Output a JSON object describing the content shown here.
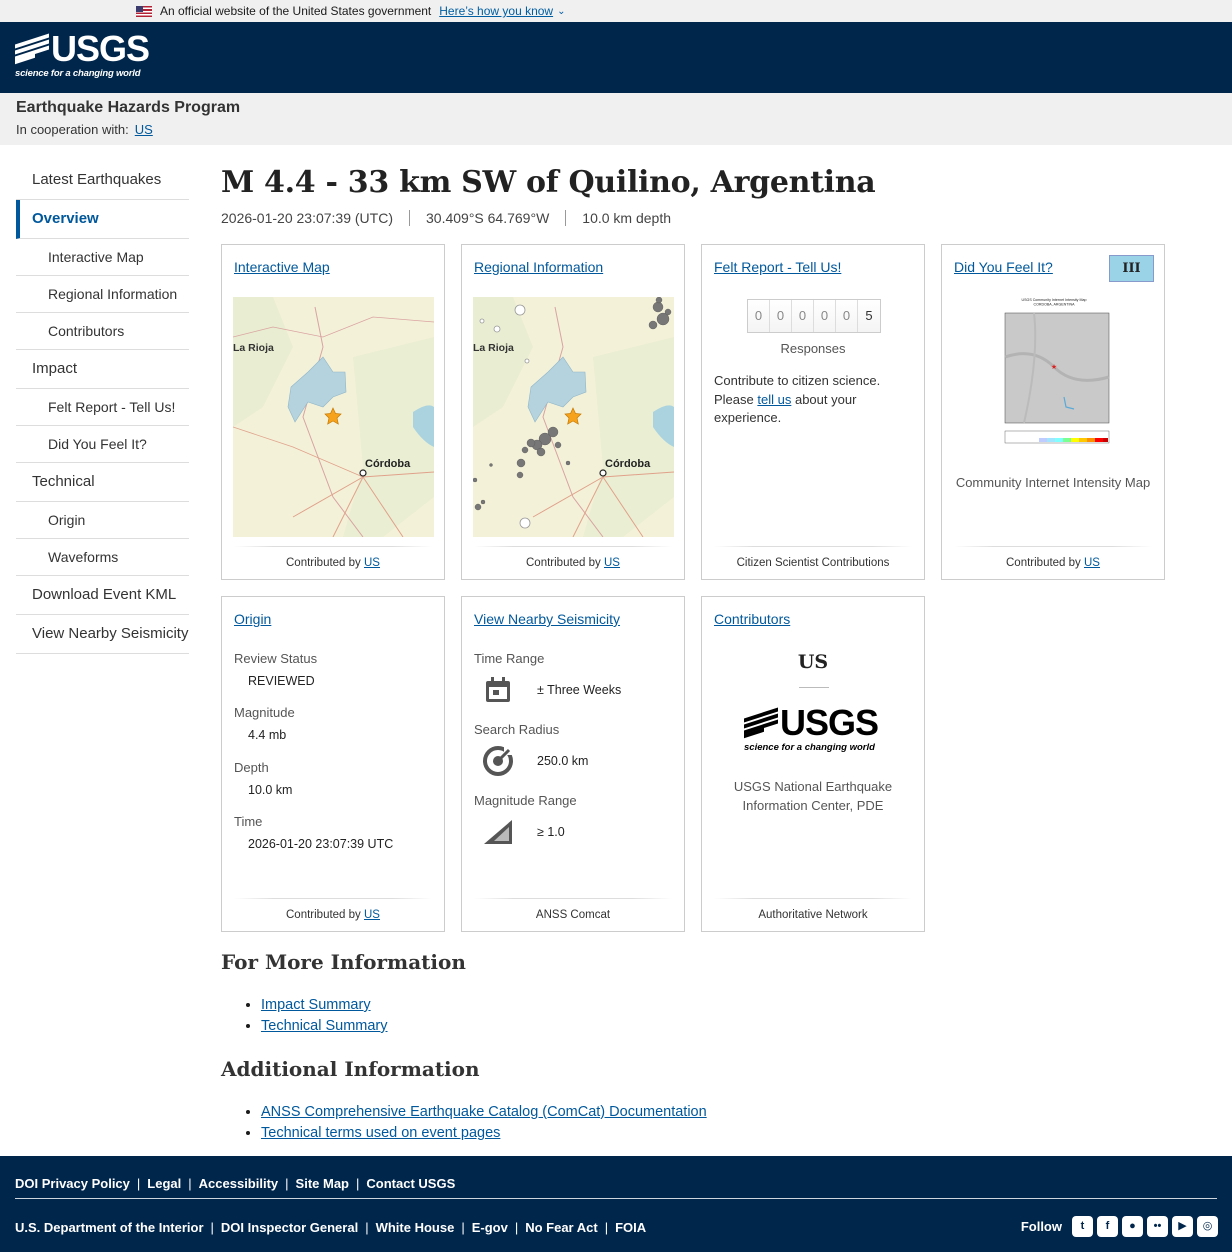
{
  "gov_banner": {
    "text": "An official website of the United States government",
    "link": "Here’s how you know"
  },
  "header": {
    "logo_text": "USGS",
    "logo_tagline": "science for a changing world"
  },
  "site": {
    "title": "Earthquake Hazards Program",
    "coop_label": "In cooperation with:",
    "coop_link": "US"
  },
  "sidebar": {
    "items": [
      {
        "label": "Latest Earthquakes"
      },
      {
        "label": "Overview"
      },
      {
        "label": "Interactive Map"
      },
      {
        "label": "Regional Information"
      },
      {
        "label": "Contributors"
      },
      {
        "label": "Impact"
      },
      {
        "label": "Felt Report - Tell Us!"
      },
      {
        "label": "Did You Feel It?"
      },
      {
        "label": "Technical"
      },
      {
        "label": "Origin"
      },
      {
        "label": "Waveforms"
      },
      {
        "label": "Download Event KML"
      },
      {
        "label": "View Nearby Seismicity"
      }
    ]
  },
  "event": {
    "title": "M 4.4 - 33 km SW of Quilino, Argentina",
    "time": "2026-01-20 23:07:39 (UTC)",
    "location": "30.409°S 64.769°W",
    "depth": "10.0 km depth"
  },
  "cards": {
    "map": {
      "title": "Interactive Map",
      "foot_prefix": "Contributed by",
      "foot_link": "US",
      "label_la_rioja": "La Rioja",
      "label_cordoba": "Córdoba"
    },
    "regional": {
      "title": "Regional Information",
      "foot_prefix": "Contributed by",
      "foot_link": "US",
      "label_la_rioja": "La Rioja",
      "label_cordoba": "Córdoba"
    },
    "felt": {
      "title": "Felt Report - Tell Us!",
      "digits": [
        "0",
        "0",
        "0",
        "0",
        "0",
        "5"
      ],
      "responses_label": "Responses",
      "text_1": "Contribute to citizen science. Please",
      "link": "tell us",
      "text_2": "about your experience.",
      "foot": "Citizen Scientist Contributions"
    },
    "dyfi": {
      "title": "Did You Feel It?",
      "mmi": "III",
      "caption": "Community Internet Intensity Map",
      "foot_prefix": "Contributed by",
      "foot_link": "US",
      "map_title": "USGS Community Internet Intensity Map",
      "map_subtitle": "CORDOBA, ARGENTINA"
    },
    "origin": {
      "title": "Origin",
      "review_label": "Review Status",
      "review_value": "REVIEWED",
      "magnitude_label": "Magnitude",
      "magnitude_value": "4.4 mb",
      "depth_label": "Depth",
      "depth_value": "10.0 km",
      "time_label": "Time",
      "time_value": "2026-01-20 23:07:39 UTC",
      "foot_prefix": "Contributed by",
      "foot_link": "US"
    },
    "nearby": {
      "title": "View Nearby Seismicity",
      "time_label": "Time Range",
      "time_value": "± Three Weeks",
      "radius_label": "Search Radius",
      "radius_value": "250.0 km",
      "mag_label": "Magnitude Range",
      "mag_value": "≥ 1.0",
      "foot": "ANSS Comcat"
    },
    "contributors": {
      "title": "Contributors",
      "code": "US",
      "logo_text": "USGS",
      "logo_tagline": "science for a changing world",
      "name": "USGS National Earthquake Information Center, PDE",
      "foot": "Authoritative Network"
    }
  },
  "more_info": {
    "heading": "For More Information",
    "links": [
      "Impact Summary",
      "Technical Summary"
    ]
  },
  "additional_info": {
    "heading": "Additional Information",
    "links": [
      "ANSS Comprehensive Earthquake Catalog (ComCat) Documentation",
      "Technical terms used on event pages"
    ]
  },
  "footer": {
    "row1": [
      "DOI Privacy Policy",
      "Legal",
      "Accessibility",
      "Site Map",
      "Contact USGS"
    ],
    "row2": [
      "U.S. Department of the Interior",
      "DOI Inspector General",
      "White House",
      "E-gov",
      "No Fear Act",
      "FOIA"
    ],
    "follow_label": "Follow"
  },
  "colors": {
    "header_bg": "#00264c",
    "link": "#00589c",
    "mmi_badge": "#9ad2e8"
  }
}
